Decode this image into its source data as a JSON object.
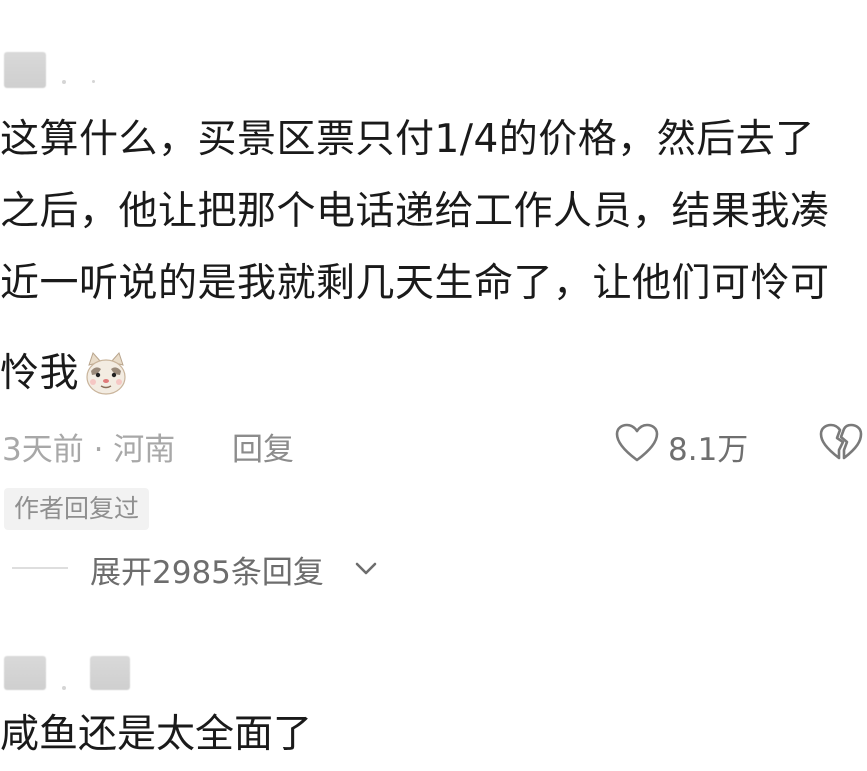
{
  "comment1": {
    "lines": [
      "这算什么，买景区票只付1/4的价格，然后去了",
      "之后，他让把那个电话递给工作人员，结果我凑",
      "近一听说的是我就剩几天生命了，让他们可怜可",
      "怜我"
    ],
    "emoji": "cat-face-emoji",
    "time_location": "3天前 · 河南",
    "reply_label": "回复",
    "like_count": "8.1万",
    "author_badge": "作者回复过",
    "expand_label": "展开2985条回复"
  },
  "comment2": {
    "text": "咸鱼还是太全面了"
  },
  "icons": {
    "like": "heart-outline-icon",
    "dislike": "broken-heart-icon",
    "expand": "chevron-down-icon"
  },
  "colors": {
    "text_primary": "#1a1a1a",
    "text_meta": "#a8a8a8",
    "text_secondary": "#6d6d6d",
    "badge_bg": "#f2f2f2"
  }
}
